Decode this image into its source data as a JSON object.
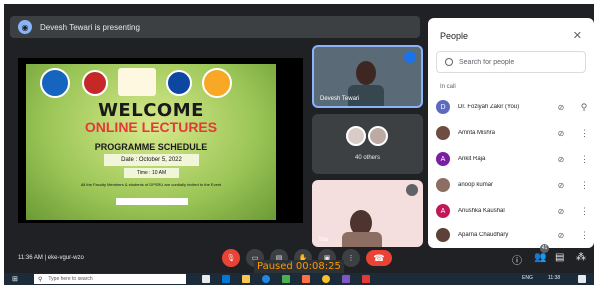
{
  "presenter": {
    "text": "Devesh Tewari is presenting"
  },
  "slide": {
    "welcome": "WELCOME",
    "online": "ONLINE LECTURES",
    "schedule": "PROGRAMME SCHEDULE",
    "date": "Date : October 5, 2022",
    "time": "Time : 10 AM",
    "invite": "All the Faculty Members & students of DPSRU are cordially invited to the Event"
  },
  "tiles": {
    "tile1_label": "Devesh Tewari",
    "others_label": "40 others",
    "tile3_label": "You"
  },
  "people": {
    "title": "People",
    "search_placeholder": "Search for people",
    "section": "In call",
    "list": [
      {
        "initial": "D",
        "name": "Dr. Foziyah Zakir (You)",
        "color": "#5c6bc0"
      },
      {
        "initial": "",
        "name": "Amrita Mishra",
        "color": "#6d4c41"
      },
      {
        "initial": "A",
        "name": "Ankit Raja",
        "color": "#7b1fa2"
      },
      {
        "initial": "",
        "name": "anoop kumar",
        "color": "#8d6e63"
      },
      {
        "initial": "A",
        "name": "Anushka Kaushal",
        "color": "#c2185b"
      },
      {
        "initial": "",
        "name": "Aparna Chaudhary",
        "color": "#5d4037"
      }
    ]
  },
  "controls": {
    "meeting_info": "11:36 AM  |  eke-vgur-wzo",
    "participants_badge": "41"
  },
  "overlay": {
    "paused": "Paused 00:08:25"
  },
  "taskbar": {
    "search_text": "Type here to search",
    "clock": "11:38",
    "lang": "ENG"
  }
}
